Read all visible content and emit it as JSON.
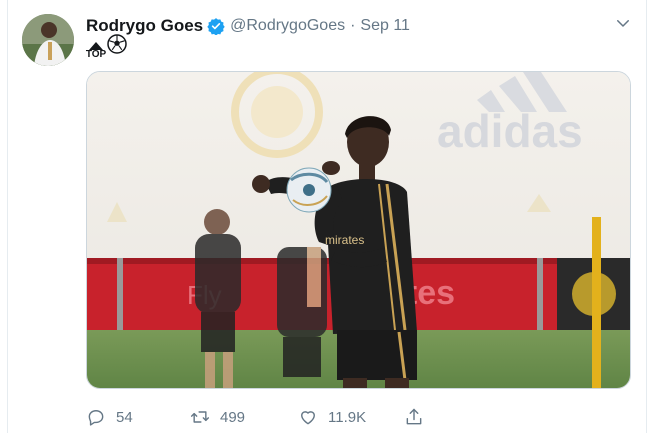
{
  "tweet": {
    "author_name": "Rodrygo Goes",
    "handle": "@RodrygoGoes",
    "separator": "·",
    "date": "Sep 11",
    "badge_text": "TOP"
  },
  "media": {
    "banner_text": "adidas"
  },
  "actions": {
    "replies": "54",
    "retweets": "499",
    "likes": "11.9K"
  },
  "icons": {
    "verified": "verified-badge-icon",
    "menu": "chevron-down-icon",
    "reply": "reply-icon",
    "retweet": "retweet-icon",
    "like": "heart-icon",
    "share": "share-icon"
  },
  "colors": {
    "verified_blue": "#1da1f2",
    "secondary_text": "#657786"
  }
}
